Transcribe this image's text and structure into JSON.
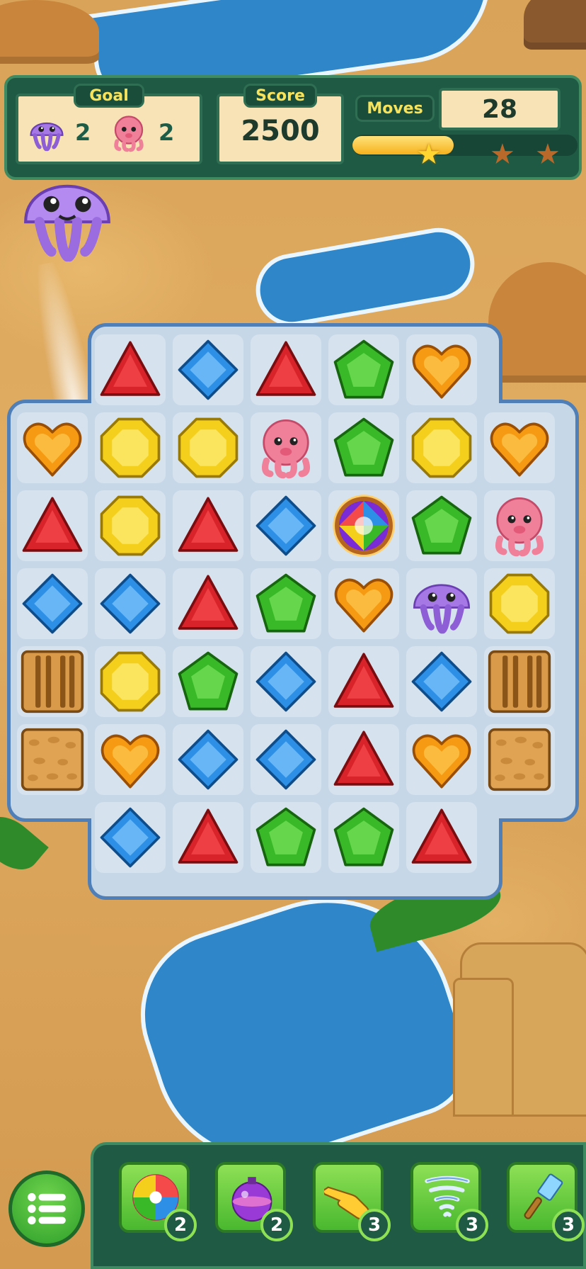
{
  "hud": {
    "goal_label": "Goal",
    "score_label": "Score",
    "moves_label": "Moves",
    "goals": [
      {
        "icon": "jellyfish-icon",
        "count": "2"
      },
      {
        "icon": "octopus-icon",
        "count": "2"
      }
    ],
    "score": "2500",
    "moves": "28",
    "progress_fraction": 0.45,
    "stars_earned": 1,
    "stars_total": 3
  },
  "colors": {
    "red": "#d9232a",
    "blue": "#2e8fe6",
    "green": "#39b928",
    "yellow": "#f4cf1c",
    "orange": "#f59a12",
    "jelly": "#a678e6",
    "octo": "#f07f9a"
  },
  "board": {
    "rows": [
      [
        "none",
        "red-triangle",
        "blue-diamond",
        "red-triangle",
        "green-pentagon",
        "orange-heart",
        "none"
      ],
      [
        "orange-heart",
        "yellow-octagon",
        "yellow-octagon",
        "octopus",
        "green-pentagon",
        "yellow-octagon",
        "orange-heart"
      ],
      [
        "red-triangle",
        "yellow-octagon",
        "red-triangle",
        "blue-diamond",
        "rainbow-orb",
        "green-pentagon",
        "octopus"
      ],
      [
        "blue-diamond",
        "blue-diamond",
        "red-triangle",
        "green-pentagon",
        "orange-heart",
        "jellyfish",
        "yellow-octagon"
      ],
      [
        "crate-barrier",
        "yellow-octagon",
        "green-pentagon",
        "blue-diamond",
        "red-triangle",
        "blue-diamond",
        "crate-barrier"
      ],
      [
        "sand-block",
        "orange-heart",
        "blue-diamond",
        "blue-diamond",
        "red-triangle",
        "orange-heart",
        "sand-block"
      ],
      [
        "none",
        "blue-diamond",
        "red-triangle",
        "green-pentagon",
        "green-pentagon",
        "red-triangle",
        "none"
      ]
    ]
  },
  "boosters": [
    {
      "name": "swirl-candy-icon",
      "count": "2"
    },
    {
      "name": "bomb-icon",
      "count": "2"
    },
    {
      "name": "pointing-hand-icon",
      "count": "3"
    },
    {
      "name": "tornado-icon",
      "count": "3"
    },
    {
      "name": "wand-icon",
      "count": "3"
    }
  ]
}
